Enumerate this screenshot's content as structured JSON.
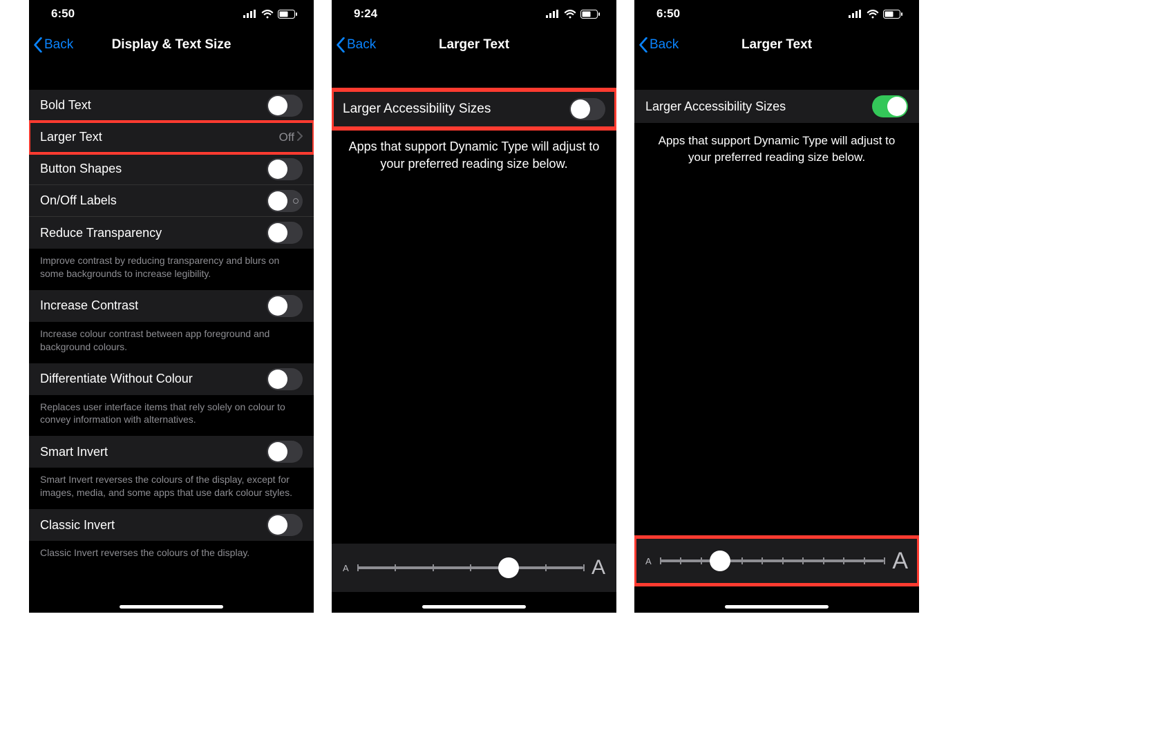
{
  "screens": {
    "s1": {
      "time": "6:50",
      "back": "Back",
      "title": "Display & Text Size",
      "rows": {
        "bold": "Bold Text",
        "larger": "Larger Text",
        "larger_val": "Off",
        "button_shapes": "Button Shapes",
        "onoff": "On/Off Labels",
        "reduce_trans": "Reduce Transparency",
        "reduce_trans_foot": "Improve contrast by reducing transparency and blurs on some backgrounds to increase legibility.",
        "increase_contrast": "Increase Contrast",
        "increase_contrast_foot": "Increase colour contrast between app foreground and background colours.",
        "diff_colour": "Differentiate Without Colour",
        "diff_colour_foot": "Replaces user interface items that rely solely on colour to convey information with alternatives.",
        "smart_invert": "Smart Invert",
        "smart_invert_foot": "Smart Invert reverses the colours of the display, except for images, media, and some apps that use dark colour styles.",
        "classic_invert": "Classic Invert",
        "classic_invert_foot": "Classic Invert reverses the colours of the display."
      }
    },
    "s2": {
      "time": "9:24",
      "back": "Back",
      "title": "Larger Text",
      "row_label": "Larger Accessibility Sizes",
      "desc": "Apps that support Dynamic Type will adjust to your preferred reading size below.",
      "slider": {
        "ticks": 7,
        "position_pct": 67
      },
      "small_a": "A",
      "big_a": "A"
    },
    "s3": {
      "time": "6:50",
      "back": "Back",
      "title": "Larger Text",
      "row_label": "Larger Accessibility Sizes",
      "desc": "Apps that support Dynamic Type will adjust to your preferred reading size below.",
      "slider": {
        "ticks": 12,
        "position_pct": 27
      },
      "small_a": "A",
      "big_a": "A"
    }
  }
}
